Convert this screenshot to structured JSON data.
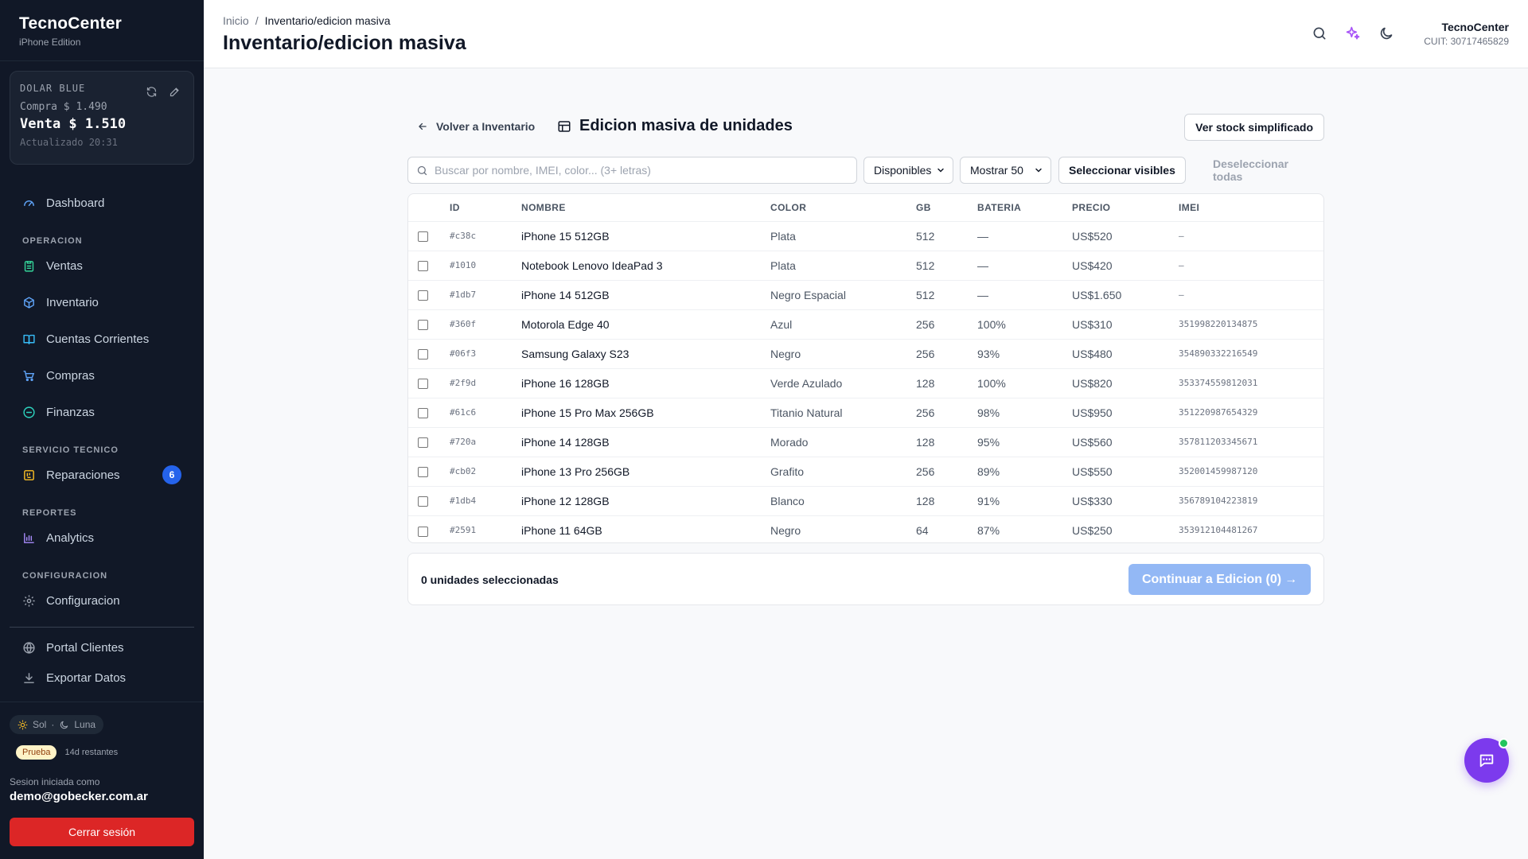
{
  "brand": {
    "name": "TecnoCenter",
    "edition": "iPhone Edition"
  },
  "dolar": {
    "title": "DOLAR BLUE",
    "compra": "Compra $ 1.490",
    "venta": "Venta $ 1.510",
    "updated": "Actualizado 20:31"
  },
  "nav": {
    "dashboard": "Dashboard",
    "sec_operacion": "OPERACION",
    "ventas": "Ventas",
    "inventario": "Inventario",
    "cuentas": "Cuentas Corrientes",
    "compras": "Compras",
    "finanzas": "Finanzas",
    "sec_servicio": "SERVICIO TECNICO",
    "reparaciones": "Reparaciones",
    "reparaciones_badge": "6",
    "sec_reportes": "REPORTES",
    "analytics": "Analytics",
    "sec_config": "CONFIGURACION",
    "configuracion": "Configuracion",
    "portal": "Portal Clientes",
    "exportar": "Exportar Datos"
  },
  "theme": {
    "sol": "Sol",
    "sep": "·",
    "luna": "Luna"
  },
  "trial": {
    "label": "Prueba",
    "days": "14d restantes"
  },
  "session": {
    "label": "Sesion iniciada como",
    "email": "demo@gobecker.com.ar",
    "logout": "Cerrar sesión"
  },
  "header": {
    "crumb_home": "Inicio",
    "crumb_sep": "/",
    "crumb_current": "Inventario/edicion masiva",
    "title": "Inventario/edicion masiva",
    "company_name": "TecnoCenter",
    "company_cuit": "CUIT: 30717465829"
  },
  "main": {
    "back": "Volver a Inventario",
    "section_title": "Edicion masiva de unidades",
    "simplified": "Ver stock simplificado",
    "search_placeholder": "Buscar por nombre, IMEI, color... (3+ letras)",
    "filter_status": "Disponibles",
    "filter_show": "Mostrar 50",
    "select_visible": "Seleccionar visibles",
    "deselect_all": "Deseleccionar todas",
    "selected_count": "0 unidades seleccionadas",
    "continue": "Continuar a Edicion (0)",
    "continue_arrow": "→"
  },
  "table": {
    "headers": {
      "id": "ID",
      "nombre": "NOMBRE",
      "color": "COLOR",
      "gb": "GB",
      "bateria": "BATERIA",
      "precio": "PRECIO",
      "imei": "IMEI"
    },
    "rows": [
      {
        "id": "#c38c",
        "nombre": "iPhone 15 512GB",
        "color": "Plata",
        "gb": "512",
        "bateria": "—",
        "precio": "US$520",
        "imei": "–"
      },
      {
        "id": "#1010",
        "nombre": "Notebook Lenovo IdeaPad 3",
        "color": "Plata",
        "gb": "512",
        "bateria": "—",
        "precio": "US$420",
        "imei": "–"
      },
      {
        "id": "#1db7",
        "nombre": "iPhone 14 512GB",
        "color": "Negro Espacial",
        "gb": "512",
        "bateria": "—",
        "precio": "US$1.650",
        "imei": "–"
      },
      {
        "id": "#360f",
        "nombre": "Motorola Edge 40",
        "color": "Azul",
        "gb": "256",
        "bateria": "100%",
        "precio": "US$310",
        "imei": "351998220134875"
      },
      {
        "id": "#06f3",
        "nombre": "Samsung Galaxy S23",
        "color": "Negro",
        "gb": "256",
        "bateria": "93%",
        "precio": "US$480",
        "imei": "354890332216549"
      },
      {
        "id": "#2f9d",
        "nombre": "iPhone 16 128GB",
        "color": "Verde Azulado",
        "gb": "128",
        "bateria": "100%",
        "precio": "US$820",
        "imei": "353374559812031"
      },
      {
        "id": "#61c6",
        "nombre": "iPhone 15 Pro Max 256GB",
        "color": "Titanio Natural",
        "gb": "256",
        "bateria": "98%",
        "precio": "US$950",
        "imei": "351220987654329"
      },
      {
        "id": "#720a",
        "nombre": "iPhone 14 128GB",
        "color": "Morado",
        "gb": "128",
        "bateria": "95%",
        "precio": "US$560",
        "imei": "357811203345671"
      },
      {
        "id": "#cb02",
        "nombre": "iPhone 13 Pro 256GB",
        "color": "Grafito",
        "gb": "256",
        "bateria": "89%",
        "precio": "US$550",
        "imei": "352001459987120"
      },
      {
        "id": "#1db4",
        "nombre": "iPhone 12 128GB",
        "color": "Blanco",
        "gb": "128",
        "bateria": "91%",
        "precio": "US$330",
        "imei": "356789104223819"
      },
      {
        "id": "#2591",
        "nombre": "iPhone 11 64GB",
        "color": "Negro",
        "gb": "64",
        "bateria": "87%",
        "precio": "US$250",
        "imei": "353912104481267"
      }
    ]
  },
  "colors": {
    "sidebar_bg": "#111827",
    "accent_blue": "#2563eb",
    "continue_disabled": "#93b8f5",
    "chat_purple": "#7c3aed",
    "logout_red": "#dc2626",
    "online_green": "#22c55e"
  },
  "icons": {
    "refresh": "refresh-icon",
    "edit": "pencil-icon",
    "dashboard": "gauge-icon",
    "ventas": "clipboard-icon",
    "inventario": "box-icon",
    "cuentas": "book-icon",
    "compras": "cart-icon",
    "finanzas": "minus-circle-icon",
    "reparaciones": "wrench-board-icon",
    "analytics": "bar-chart-icon",
    "config": "gear-icon",
    "portal": "globe-icon",
    "exportar": "download-icon",
    "search": "search-icon",
    "sparkles": "sparkles-icon",
    "moon": "moon-icon",
    "back": "arrow-left-icon",
    "table": "table-icon",
    "chevron": "chevron-down-icon",
    "chat": "chat-icon"
  }
}
